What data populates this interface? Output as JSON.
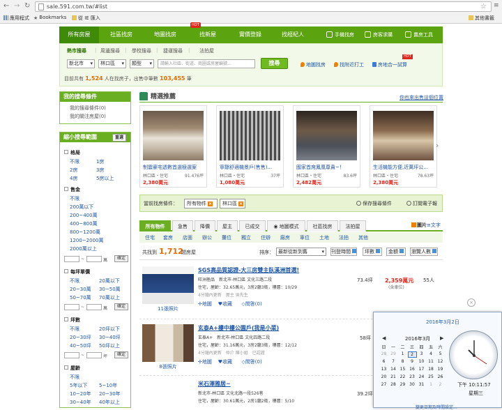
{
  "browser": {
    "url": "sale.591.com.tw/#list",
    "bookmarks": [
      {
        "label": "應用程式"
      },
      {
        "label": "Bookmarks"
      },
      {
        "label": "從 IE 匯入"
      },
      {
        "label": "其他書籤"
      }
    ]
  },
  "nav": {
    "items": [
      "所有房屋",
      "社區找房",
      "地圖找房",
      "找新屋",
      "實價登錄",
      "找經紀人"
    ],
    "hot": "HOT",
    "right": [
      "手機找房",
      "房客求購",
      "賣房工具"
    ]
  },
  "search": {
    "tabs": [
      "熱市搜尋",
      "周邊搜尋",
      "學校搜尋",
      "捷運搜尋",
      "法拍屋"
    ],
    "city": "新北市",
    "district": "林口區",
    "type": "類型",
    "placeholder": "請輸入社區、街道、商圈或房屋編號...",
    "button": "搜尋",
    "tools": [
      "地圖找房",
      "找附近打工",
      "房地合一試算"
    ],
    "hot": "HOT",
    "stats": {
      "prefix": "目前共有",
      "count1": "1,524",
      "mid": "人在找房子，出售中筆數",
      "count2": "103,455",
      "suffix": "筆"
    }
  },
  "sidebar": {
    "my_title": "我的搜尋條件",
    "my_links": [
      "我的搜尋條件(0)",
      "我的關注房屋(0)"
    ],
    "narrow_title": "縮小搜尋範圍",
    "reset": "重選",
    "groups": [
      {
        "title": "格局",
        "opts": [
          "不限",
          "1房",
          "2房",
          "3房",
          "4房",
          "5房以上"
        ]
      },
      {
        "title": "售金",
        "opts": [
          "不限",
          "200萬以下",
          "200~400萬",
          "400~800萬",
          "800~1200萬",
          "1200~2000萬",
          "2000萬以上"
        ]
      },
      {
        "title": "每坪單價",
        "opts": [
          "不限",
          "20萬以下",
          "20~30萬",
          "30~50萬",
          "50~70萬",
          "70萬以上"
        ]
      },
      {
        "title": "坪數",
        "opts": [
          "不限",
          "20坪以下",
          "20~30坪",
          "30~40坪",
          "40~50坪",
          "50坪以上"
        ]
      },
      {
        "title": "屋齡",
        "opts": [
          "不限",
          "5年以下",
          "5~10年",
          "10~20年",
          "20~30年",
          "30~40年",
          "40年以上"
        ]
      }
    ],
    "range_sep": "~",
    "unit_wan": "萬",
    "unit_ping": "坪",
    "set_btn": "確定"
  },
  "featured": {
    "title": "精選推薦",
    "link": "你也來出售這個位置",
    "cards": [
      {
        "title": "制震豪宅透數首選極選案",
        "loc": "林口區・住宅",
        "size": "91.476坪",
        "price": "2,380萬元"
      },
      {
        "title": "寧靜舒適機景戶(售售)...",
        "loc": "林口區・住宅",
        "size": "37坪",
        "price": "1,080萬元"
      },
      {
        "title": "國家首席鳳凰尊貴~！",
        "loc": "林口區・住宅",
        "size": "83.6坪",
        "price": "2,482萬元"
      },
      {
        "title": "生活機能方便,近萬坪公...",
        "loc": "林口區・住宅",
        "size": "78.63坪",
        "price": "2,380萬元"
      }
    ],
    "next": "›"
  },
  "conditions": {
    "label": "當前找房條件：",
    "chips": [
      "所有物件",
      "林口區"
    ],
    "chip_x": "×",
    "save": "保存搜尋條件",
    "subscribe": "訂閱電子報"
  },
  "tabs": {
    "items": [
      "所有物件",
      "急售",
      "降價",
      "屋主",
      "已成交",
      "地圖模式",
      "社區找房",
      "法拍屋"
    ],
    "view_img": "圖片",
    "view_txt": "文字",
    "sub": [
      "住宅",
      "套房",
      "店面",
      "辦公",
      "攤位",
      "獨立",
      "住辦",
      "廠房",
      "車位",
      "土地",
      "法拍",
      "其他"
    ]
  },
  "sort": {
    "prefix": "共找到",
    "total": "1,712",
    "unit": "間房屋",
    "label": "排序：",
    "select": "最新從新到舊",
    "buttons": [
      "刊登時間",
      "坪數",
      "金額",
      "瀏覽人數"
    ]
  },
  "listings": [
    {
      "title": "SGS高品質認證-大三房雙主臥溪洲首選!",
      "l1": "旺洲極品　新北市-林口區 文化三路二段",
      "l2": "住宅，屋齡：32.65萬元，3房2廳3衛，樓層：10/29",
      "l3": "4分鐘內更新　屋主 吳先生",
      "actions": [
        "地圖",
        "收藏",
        "問答(0)"
      ],
      "photos": "11張照片",
      "area": "73.4坪",
      "price": "2,359萬元",
      "price_note": "(含車位)",
      "views": "55人"
    },
    {
      "title": "玄泰A+樓中樓公園戶(我是小菜)",
      "l1": "玄泰A+　新北市-林口區 文化四路二段",
      "l2": "住宅，屋齡：31.16萬元，3房2廳3衛，樓層：12/12",
      "l3": "4分鐘內更新　仲介 陳小姐　已認證",
      "actions": [
        "地圖",
        "收藏",
        "問答(0)"
      ],
      "photos": "8張照片",
      "area": "58坪",
      "price": "",
      "price_note": "",
      "views": ""
    },
    {
      "title": "米石澤雅居~",
      "l1": "新北市-林口區 文化北路一段526巷",
      "l2": "住宅，屋齡：30.61萬元，2房1廳2衛，樓層：5/10",
      "l3": "",
      "actions": [],
      "photos": "",
      "area": "39.2坪",
      "price": "",
      "price_note": "",
      "views": ""
    }
  ],
  "calendar": {
    "date": "2016年3月2日",
    "month": "2016年3月",
    "prev": "◀",
    "next": "▶",
    "weekdays": [
      "日",
      "一",
      "二",
      "三",
      "四",
      "五",
      "六"
    ],
    "rows": [
      [
        "28",
        "29",
        "1",
        "2",
        "3",
        "4",
        "5"
      ],
      [
        "6",
        "7",
        "8",
        "9",
        "10",
        "11",
        "12"
      ],
      [
        "13",
        "14",
        "15",
        "16",
        "17",
        "18",
        "19"
      ],
      [
        "20",
        "21",
        "22",
        "23",
        "24",
        "25",
        "26"
      ],
      [
        "27",
        "28",
        "29",
        "30",
        "31",
        "1",
        "2"
      ]
    ],
    "time": "下午 10:11:57",
    "weekday": "星期三",
    "link": "變更日期及時間設定..."
  }
}
